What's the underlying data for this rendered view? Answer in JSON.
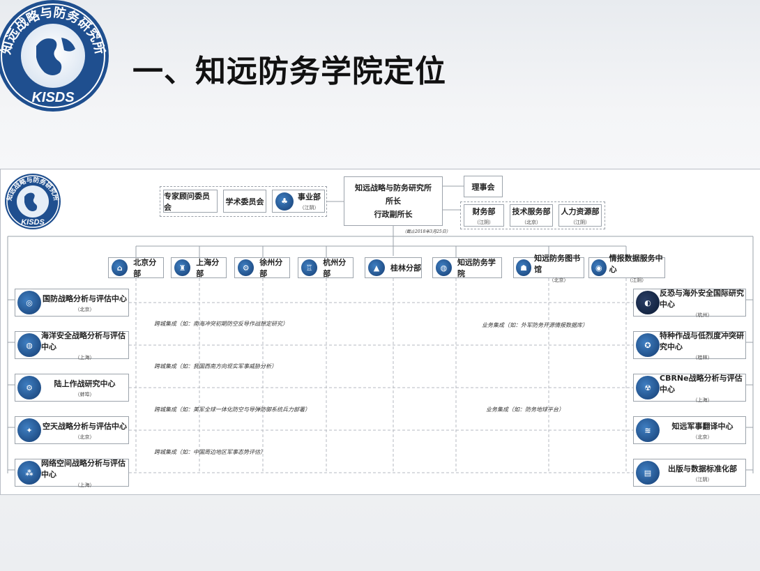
{
  "slide": {
    "title": "一、知远防务学院定位"
  },
  "logo": {
    "ring_text": "知远战略与防务研究所",
    "abbr": "KISDS"
  },
  "top": {
    "center": {
      "name": "知远战略与防务研究所",
      "line2": "所长",
      "line3": "行政副所长"
    },
    "left_group": [
      {
        "label": "专家顾问委员会"
      },
      {
        "label": "学术委员会"
      },
      {
        "label": "事业部",
        "loc": "（江阴）"
      }
    ],
    "board": "理事会",
    "right_group": [
      {
        "label": "财务部",
        "loc": "（江阴）"
      },
      {
        "label": "技术服务部",
        "loc": "（北京）"
      },
      {
        "label": "人力资源部",
        "loc": "（江阴）"
      }
    ],
    "date_note": "（截止2018年3月25日）"
  },
  "branches": [
    {
      "label": "北京分部",
      "loc": ""
    },
    {
      "label": "上海分部",
      "loc": ""
    },
    {
      "label": "徐州分部",
      "loc": ""
    },
    {
      "label": "杭州分部",
      "loc": ""
    },
    {
      "label": "桂林分部",
      "loc": ""
    },
    {
      "label": "知远防务学院",
      "loc": ""
    },
    {
      "label": "知远防务图书馆",
      "loc": "（北京）"
    },
    {
      "label": "情报数据服务中心",
      "loc": "（江阴）"
    }
  ],
  "left_centers": [
    {
      "label": "国防战略分析与评估中心",
      "loc": "（北京）"
    },
    {
      "label": "海洋安全战略分析与评估中心",
      "loc": "（上海）"
    },
    {
      "label": "陆上作战研究中心",
      "loc": "（蚌埠）"
    },
    {
      "label": "空天战略分析与评估中心",
      "loc": "（北京）"
    },
    {
      "label": "网络空间战略分析与评估中心",
      "loc": "（上海）"
    }
  ],
  "right_centers": [
    {
      "label": "反恐与海外安全国际研究中心",
      "loc": "（杭州）"
    },
    {
      "label": "特种作战与低烈度冲突研究中心",
      "loc": "（桂林）"
    },
    {
      "label": "CBRNe战略分析与评估中心",
      "loc": "（上海）"
    },
    {
      "label": "知远军事翻译中心",
      "loc": "（北京）"
    },
    {
      "label": "出版与数据标准化部",
      "loc": "（江阴）"
    }
  ],
  "integration": [
    {
      "text": "跨城集成（如：南海冲突初期防空反导作战想定研究）"
    },
    {
      "text": "业务集成（如：外军防务开源情报数据库）"
    },
    {
      "text": "跨城集成（如：我国西南方向现实军事威胁分析）"
    },
    {
      "text": "跨城集成（如：美军全球一体化防空与导弹防御系统兵力部署）"
    },
    {
      "text": "业务集成（如：防务地球平台）"
    },
    {
      "text": "跨城集成（如：中国周边地区军事态势评估）"
    }
  ],
  "colors": {
    "seal_blue": "#1f4f8f",
    "line": "#9aa0a8"
  }
}
